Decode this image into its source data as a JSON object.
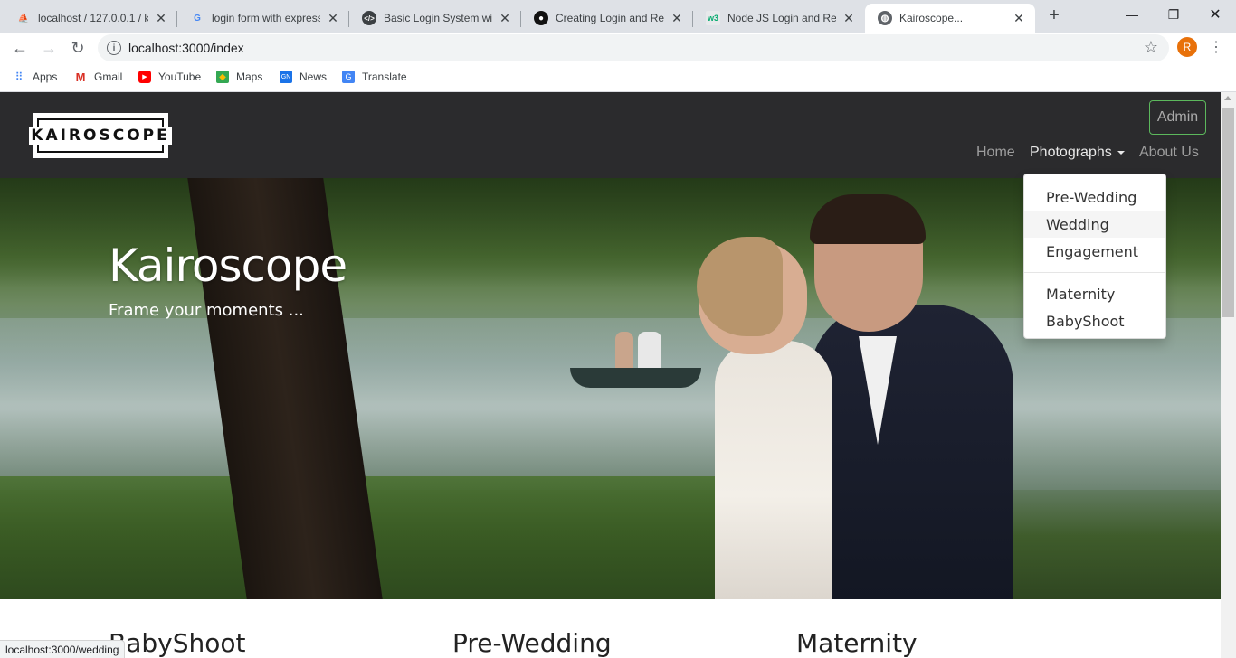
{
  "browser": {
    "tabs": [
      {
        "title": "localhost / 127.0.0.1 / k",
        "icon": "phpmyadmin-icon",
        "active": false
      },
      {
        "title": "login form with express",
        "icon": "google-icon",
        "active": false
      },
      {
        "title": "Basic Login System with",
        "icon": "code-icon",
        "active": false
      },
      {
        "title": "Creating Login and Reg",
        "icon": "github-icon",
        "active": false
      },
      {
        "title": "Node JS Login and Reg",
        "icon": "w3-icon",
        "active": false
      },
      {
        "title": "Kairoscope...",
        "icon": "globe-icon",
        "active": true
      }
    ],
    "address": "localhost:3000/index",
    "profile_initial": "R",
    "bookmarks": [
      {
        "label": "Apps",
        "icon": "apps-grid-icon"
      },
      {
        "label": "Gmail",
        "icon": "gmail-icon"
      },
      {
        "label": "YouTube",
        "icon": "youtube-icon"
      },
      {
        "label": "Maps",
        "icon": "maps-icon"
      },
      {
        "label": "News",
        "icon": "news-icon"
      },
      {
        "label": "Translate",
        "icon": "translate-icon"
      }
    ],
    "status_url": "localhost:3000/wedding"
  },
  "site": {
    "logo_text": "KAIROSCOPE",
    "admin_label": "Admin",
    "nav": {
      "home": "Home",
      "photographs": "Photographs",
      "about": "About Us"
    },
    "dropdown": {
      "items": [
        "Pre-Wedding",
        "Wedding",
        "Engagement",
        "Maternity",
        "BabyShoot"
      ],
      "hovered": "Wedding"
    },
    "hero": {
      "title": "Kairoscope",
      "subtitle": "Frame your moments ..."
    },
    "sections": [
      "BabyShoot",
      "Pre-Wedding",
      "Maternity"
    ]
  },
  "colors": {
    "navbar_bg": "#2b2b2d",
    "admin_border": "#5cb85c",
    "profile_bg": "#e8710a"
  }
}
